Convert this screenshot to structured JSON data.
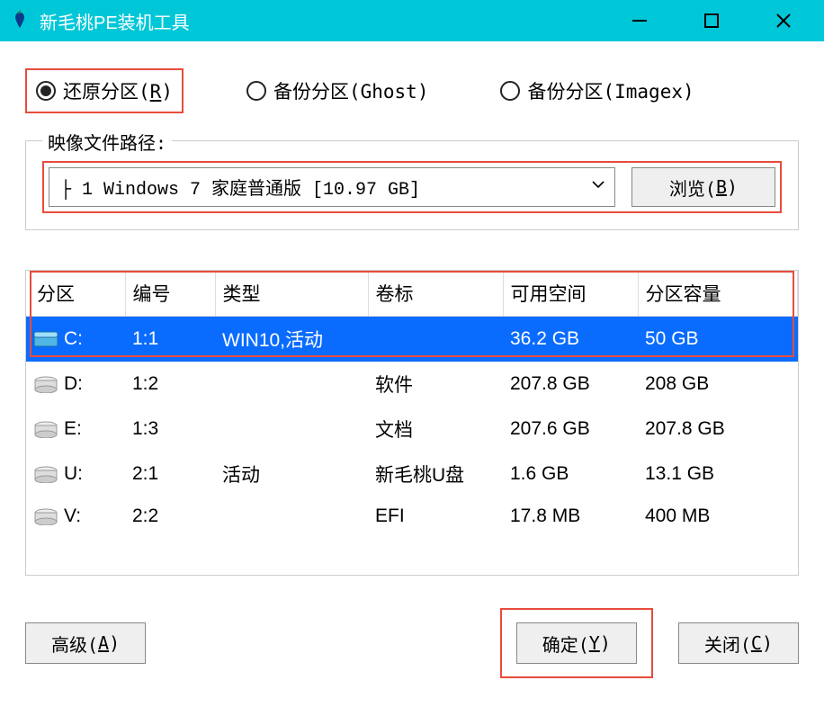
{
  "titlebar": {
    "title": "新毛桃PE装机工具"
  },
  "radios": {
    "restore": "还原分区(R)",
    "backup_ghost": "备份分区(Ghost)",
    "backup_imagex": "备份分区(Imagex)"
  },
  "image_section": {
    "legend": "映像文件路径:",
    "combo_value": "├ 1 Windows 7 家庭普通版 [10.97 GB]",
    "browse_label": "浏览(B)"
  },
  "table": {
    "headers": {
      "partition": "分区",
      "index": "编号",
      "type": "类型",
      "label": "卷标",
      "free": "可用空间",
      "capacity": "分区容量"
    },
    "rows": [
      {
        "drive": "C:",
        "index": "1:1",
        "type": "WIN10,活动",
        "label": "",
        "free": "36.2 GB",
        "capacity": "50 GB",
        "selected": true,
        "icon": "blue"
      },
      {
        "drive": "D:",
        "index": "1:2",
        "type": "",
        "label": "软件",
        "free": "207.8 GB",
        "capacity": "208 GB",
        "selected": false,
        "icon": "gray"
      },
      {
        "drive": "E:",
        "index": "1:3",
        "type": "",
        "label": "文档",
        "free": "207.6 GB",
        "capacity": "207.8 GB",
        "selected": false,
        "icon": "gray"
      },
      {
        "drive": "U:",
        "index": "2:1",
        "type": "活动",
        "label": "新毛桃U盘",
        "free": "1.6 GB",
        "capacity": "13.1 GB",
        "selected": false,
        "icon": "gray"
      },
      {
        "drive": "V:",
        "index": "2:2",
        "type": "",
        "label": "EFI",
        "free": "17.8 MB",
        "capacity": "400 MB",
        "selected": false,
        "icon": "gray"
      }
    ]
  },
  "buttons": {
    "advanced": "高级(A)",
    "ok": "确定(Y)",
    "close": "关闭(C)"
  }
}
